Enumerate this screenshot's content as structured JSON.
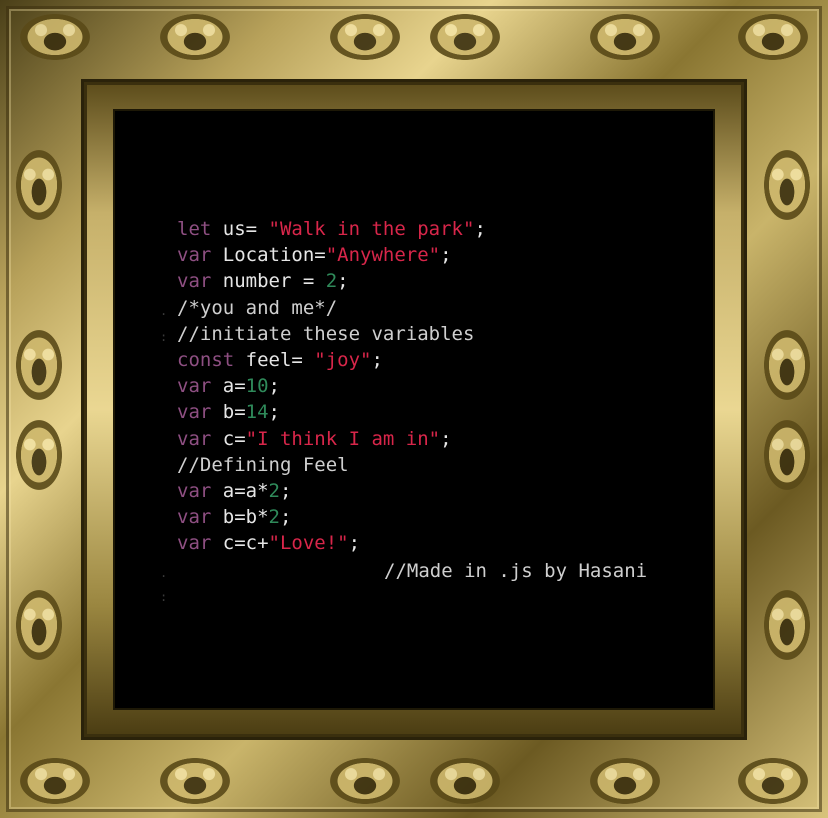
{
  "code_lines": [
    [
      {
        "t": "let",
        "c": "kw"
      },
      {
        "t": " us= ",
        "c": "txt"
      },
      {
        "t": "\"Walk in the park\"",
        "c": "str"
      },
      {
        "t": ";",
        "c": "txt"
      }
    ],
    [
      {
        "t": "var",
        "c": "kw"
      },
      {
        "t": " Location=",
        "c": "txt"
      },
      {
        "t": "\"Anywhere\"",
        "c": "str"
      },
      {
        "t": ";",
        "c": "txt"
      }
    ],
    [
      {
        "t": "var",
        "c": "kw"
      },
      {
        "t": " number = ",
        "c": "txt"
      },
      {
        "t": "2",
        "c": "num"
      },
      {
        "t": ";",
        "c": "txt"
      }
    ],
    [
      {
        "t": "/*you and me*/",
        "c": "cm"
      }
    ],
    [
      {
        "t": "//initiate these variables",
        "c": "cm"
      }
    ],
    [
      {
        "t": "const",
        "c": "kw"
      },
      {
        "t": " feel= ",
        "c": "txt"
      },
      {
        "t": "\"joy\"",
        "c": "str"
      },
      {
        "t": ";",
        "c": "txt"
      }
    ],
    [
      {
        "t": "var",
        "c": "kw"
      },
      {
        "t": " a=",
        "c": "txt"
      },
      {
        "t": "10",
        "c": "num"
      },
      {
        "t": ";",
        "c": "txt"
      }
    ],
    [
      {
        "t": "var",
        "c": "kw"
      },
      {
        "t": " b=",
        "c": "txt"
      },
      {
        "t": "14",
        "c": "num"
      },
      {
        "t": ";",
        "c": "txt"
      }
    ],
    [
      {
        "t": "var",
        "c": "kw"
      },
      {
        "t": " c=",
        "c": "txt"
      },
      {
        "t": "\"I think I am in\"",
        "c": "str"
      },
      {
        "t": ";",
        "c": "txt"
      }
    ],
    [
      {
        "t": "//Defining Feel",
        "c": "cm"
      }
    ],
    [
      {
        "t": "var",
        "c": "kw"
      },
      {
        "t": " a=a*",
        "c": "txt"
      },
      {
        "t": "2",
        "c": "num"
      },
      {
        "t": ";",
        "c": "txt"
      }
    ],
    [
      {
        "t": "var",
        "c": "kw"
      },
      {
        "t": " b=b*",
        "c": "txt"
      },
      {
        "t": "2",
        "c": "num"
      },
      {
        "t": ";",
        "c": "txt"
      }
    ],
    [
      {
        "t": "var",
        "c": "kw"
      },
      {
        "t": " c=c+",
        "c": "txt"
      },
      {
        "t": "\"Love!\"",
        "c": "str"
      },
      {
        "t": ";",
        "c": "txt"
      }
    ]
  ],
  "signature": "//Made in .js by Hasani",
  "colors": {
    "keyword": "#8e4f82",
    "string": "#d8264a",
    "number": "#2f8a5a",
    "text": "#e6e6e6",
    "comment": "#cfcfcf",
    "canvas": "#000000",
    "frame_gold": "#c9b46a"
  }
}
